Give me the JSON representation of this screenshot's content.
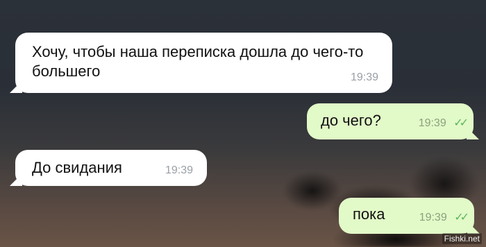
{
  "messages": [
    {
      "direction": "incoming",
      "text": "Хочу, чтобы наша переписка дошла до чего-то большего",
      "time": "19:39"
    },
    {
      "direction": "outgoing",
      "text": "до чего?",
      "time": "19:39",
      "status_icon": "double-check-icon"
    },
    {
      "direction": "incoming",
      "text": "До свидания",
      "time": "19:39"
    },
    {
      "direction": "outgoing",
      "text": "пока",
      "time": "19:39",
      "status_icon": "double-check-icon"
    }
  ],
  "watermark": "Fishki.net",
  "colors": {
    "incoming_bubble": "#ffffff",
    "outgoing_bubble": "#e2f9c8",
    "check": "#5bb85b"
  }
}
